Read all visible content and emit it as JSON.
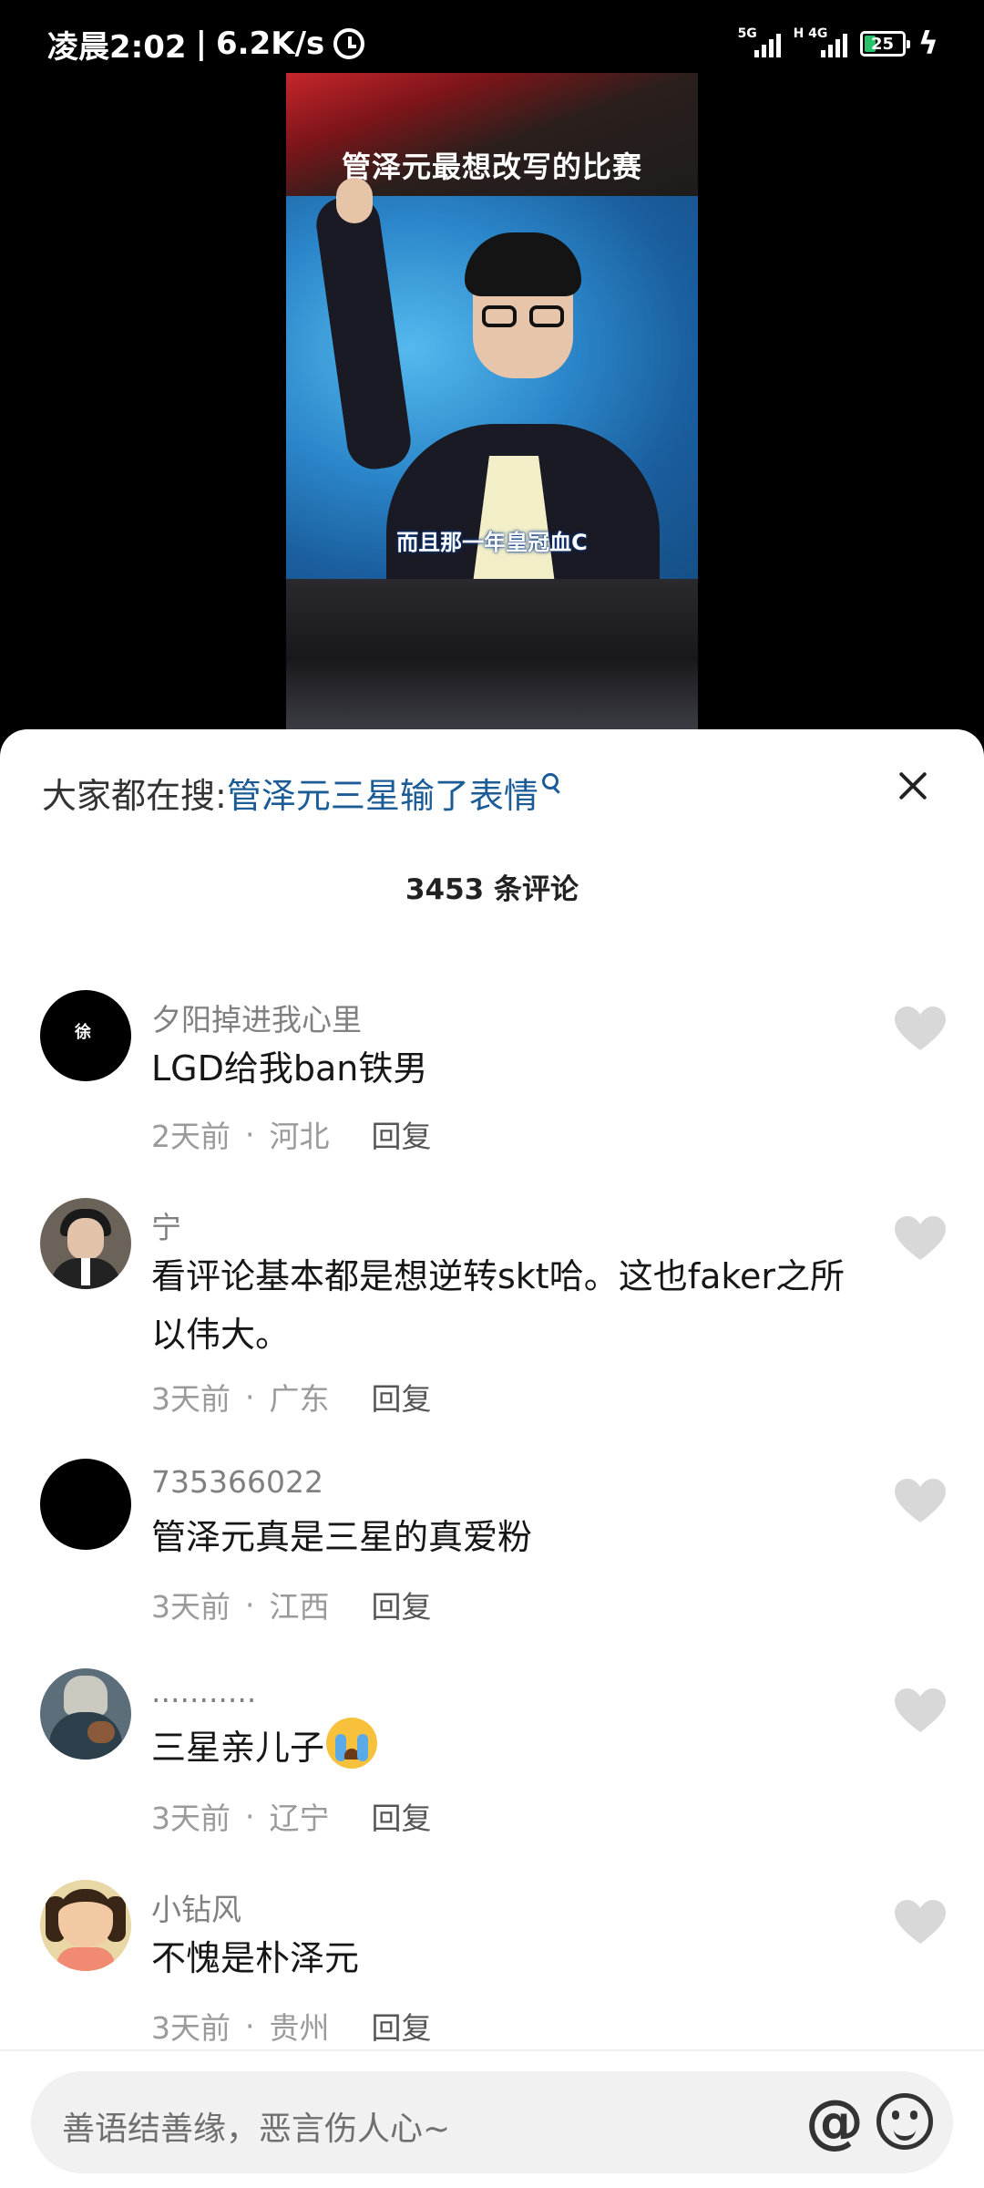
{
  "status_bar": {
    "time": "凌晨2:02",
    "speed": "6.2K/s",
    "signal1_label": "5G",
    "signal2_label": "H 4G",
    "battery": "25"
  },
  "video": {
    "title": "管泽元最想改写的比赛",
    "subtitle": "而且那一年皇冠血C"
  },
  "sheet": {
    "hot_search_label": "大家都在搜:",
    "hot_search_term": "管泽元三星输了表情",
    "comment_count": "3453 条评论"
  },
  "comments": [
    {
      "name": "夕阳掉进我心里",
      "text": "LGD给我ban铁男",
      "time": "2天前",
      "location": "河北",
      "reply": "回复",
      "avatar_mark": "徐"
    },
    {
      "name": "宁",
      "text": "看评论基本都是想逆转skt哈。这也faker之所以伟大。",
      "time": "3天前",
      "location": "广东",
      "reply": "回复"
    },
    {
      "name": "735366022",
      "text": "管泽元真是三星的真爱粉",
      "time": "3天前",
      "location": "江西",
      "reply": "回复"
    },
    {
      "name": "...........",
      "text": "三星亲儿子",
      "time": "3天前",
      "location": "辽宁",
      "reply": "回复"
    },
    {
      "name": "小钻风",
      "text": "不愧是朴泽元",
      "time": "3天前",
      "location": "贵州",
      "reply": "回复"
    }
  ],
  "colors": {
    "link": "#1c5c96",
    "heart": "#d8d8d8",
    "battery_fill": "#29c06a"
  },
  "input": {
    "placeholder": "善语结善缘，恶言伤人心~",
    "at_symbol": "@"
  }
}
